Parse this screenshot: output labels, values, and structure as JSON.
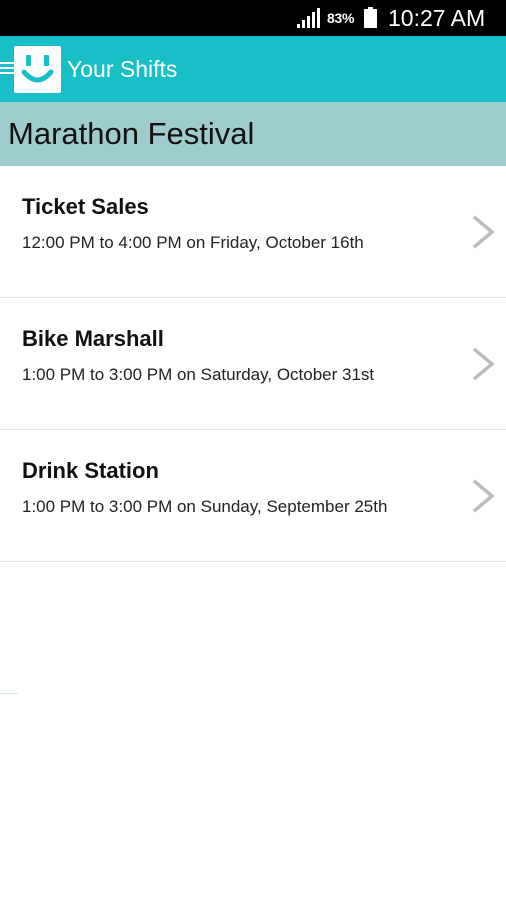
{
  "status_bar": {
    "battery_percent": "83%",
    "time": "10:27 AM"
  },
  "app_bar": {
    "title": "Your Shifts",
    "color": "#18bfc6"
  },
  "event": {
    "title": "Marathon Festival",
    "header_color": "#9ecbcb"
  },
  "shifts": [
    {
      "name": "Ticket Sales",
      "time": "12:00 PM to 4:00 PM on Friday, October 16th"
    },
    {
      "name": "Bike Marshall",
      "time": "1:00 PM to 3:00 PM on Saturday, October 31st"
    },
    {
      "name": "Drink Station",
      "time": "1:00 PM to 3:00 PM on Sunday, September 25th"
    }
  ],
  "icons": {
    "drawer": "hamburger-menu-icon",
    "logo": "smiley-logo-icon",
    "chevron": "chevron-right-icon",
    "signal": "signal-strength-icon",
    "battery": "battery-icon"
  }
}
